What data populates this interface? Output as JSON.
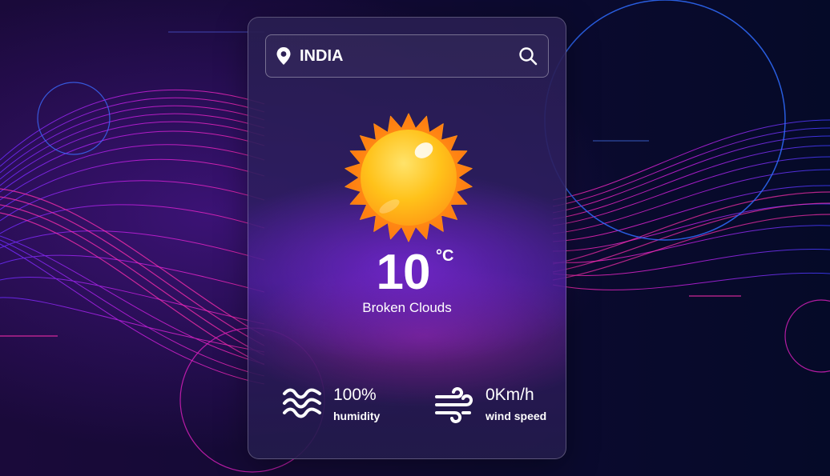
{
  "search": {
    "value": "INDIA",
    "location_icon": "map-pin-icon",
    "button_icon": "search-icon"
  },
  "weather": {
    "icon": "sun-icon",
    "temperature": "10",
    "unit": "°C",
    "condition": "Broken Clouds"
  },
  "stats": {
    "humidity": {
      "icon": "waves-icon",
      "value": "100%",
      "label": "humidity"
    },
    "wind": {
      "icon": "wind-icon",
      "value": "0Km/h",
      "label": "wind speed"
    }
  },
  "colors": {
    "background": "#140a35",
    "accent_magenta": "#e020c0",
    "accent_blue": "#3a5cff",
    "sun_core": "#ffc21a",
    "sun_rays": "#ff8a14",
    "text": "#ffffff"
  }
}
